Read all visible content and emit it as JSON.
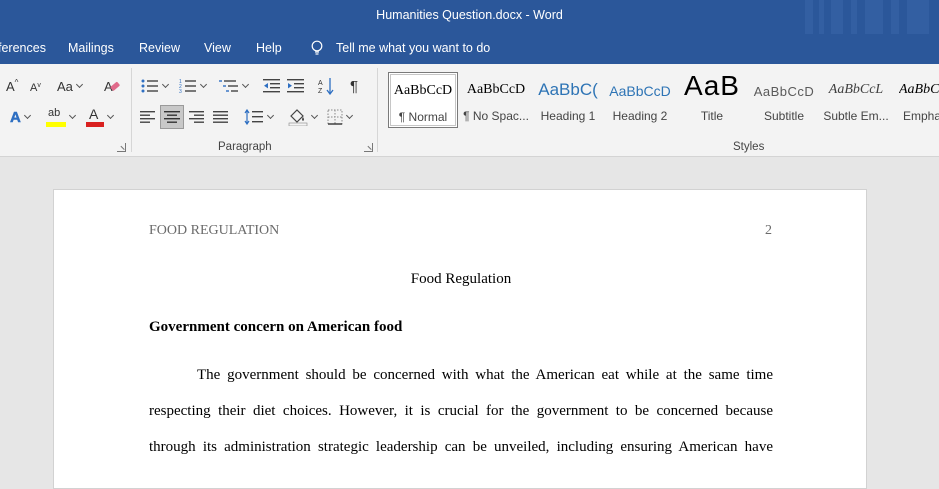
{
  "window": {
    "title": "Humanities Question.docx  -  Word"
  },
  "menu": {
    "items": [
      "ferences",
      "Mailings",
      "Review",
      "View",
      "Help"
    ],
    "tell_me": "Tell me what you want to do"
  },
  "ribbon": {
    "font_group": {
      "grow_label": "A",
      "shrink_label": "A",
      "case_label": "Aa",
      "effects_label": "A",
      "highlight_label": "ab",
      "font_color_label": "A"
    },
    "paragraph_group": {
      "label": "Paragraph"
    },
    "styles_group": {
      "label": "Styles",
      "items": [
        {
          "sample": "AaBbCcD",
          "name": "¶ Normal"
        },
        {
          "sample": "AaBbCcD",
          "name": "¶ No Spac..."
        },
        {
          "sample": "AaBbC(",
          "name": "Heading 1"
        },
        {
          "sample": "AaBbCcD",
          "name": "Heading 2"
        },
        {
          "sample": "AaB",
          "name": "Title"
        },
        {
          "sample": "AaBbCcD",
          "name": "Subtitle"
        },
        {
          "sample": "AaBbCcL",
          "name": "Subtle Em..."
        },
        {
          "sample": "AaBbCcL",
          "name": "Empha"
        }
      ]
    }
  },
  "document": {
    "running_head": "FOOD REGULATION",
    "page_number": "2",
    "title": "Food Regulation",
    "heading": "Government concern on American food",
    "paragraph_lines": [
      "The government should be concerned with what the American eat while at the same time",
      "respecting their diet choices. However, it is crucial for the government to be concerned because",
      "through its administration strategic leadership can be unveiled, including ensuring American have"
    ]
  },
  "colors": {
    "title_bar": "#2b579a",
    "ribbon_bg": "#f3f3f3",
    "highlight_yellow": "#ffff00",
    "font_color_red": "#d9201f",
    "effects_blue": "#2e6fc2",
    "heading_blue": "#2e74b5"
  }
}
